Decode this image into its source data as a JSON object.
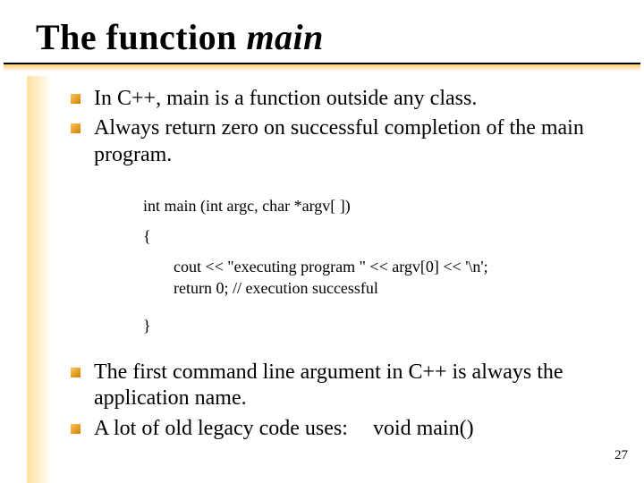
{
  "title": {
    "prefix": "The function ",
    "em": "main"
  },
  "bullets_top": [
    "In C++, main is a function outside any class.",
    "Always return zero on successful completion of the main program."
  ],
  "code": {
    "l1": "int main (int argc, char *argv[ ])",
    "l2": "{",
    "l3": "cout << \"executing program \" << argv[0] << '\\n';",
    "l4": "return 0; // execution successful",
    "l5": "}"
  },
  "bullets_bottom": [
    "The first command line argument in C++ is always the application name.",
    "A lot of old legacy code uses:"
  ],
  "legacy_sig": "void main()",
  "page_number": "27"
}
